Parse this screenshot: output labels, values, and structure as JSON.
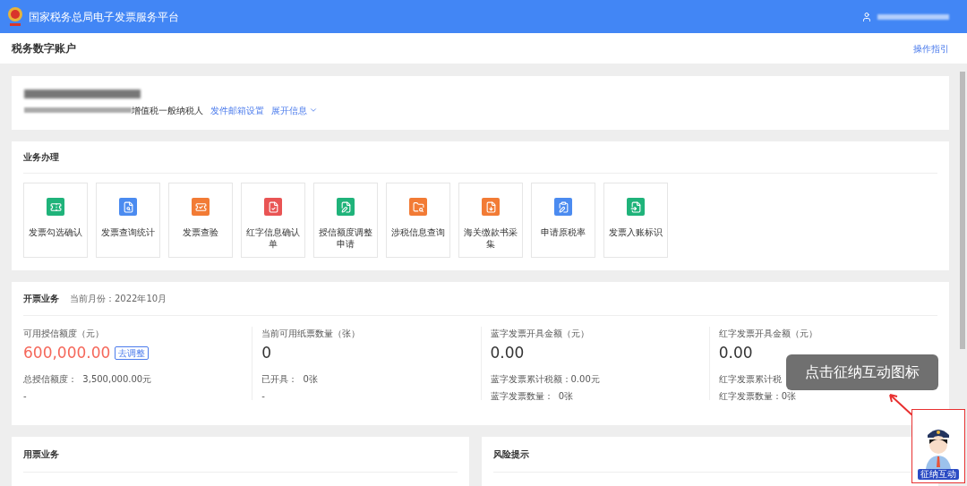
{
  "header": {
    "title": "国家税务总局电子发票服务平台"
  },
  "page": {
    "title": "税务数字账户",
    "guide_link": "操作指引"
  },
  "account": {
    "taxpayer_type": "增值税一般纳税人",
    "links": [
      {
        "label": "发件邮箱设置",
        "kind": "link"
      },
      {
        "label": "展开信息",
        "kind": "expand"
      }
    ]
  },
  "business": {
    "title": "业务办理",
    "items": [
      {
        "label": "发票勾选确认",
        "color": "#1fb37a"
      },
      {
        "label": "发票查询统计",
        "color": "#4b8bf0"
      },
      {
        "label": "发票查验",
        "color": "#f27b35"
      },
      {
        "label": "红字信息确认单",
        "color": "#e95454"
      },
      {
        "label": "授信额度调整申请",
        "color": "#1fb37a"
      },
      {
        "label": "涉税信息查询",
        "color": "#f27b35"
      },
      {
        "label": "海关缴款书采集",
        "color": "#f27b35"
      },
      {
        "label": "申请原税率",
        "color": "#4b8bf0"
      },
      {
        "label": "发票入账标识",
        "color": "#1fb37a"
      }
    ]
  },
  "invoicing": {
    "title": "开票业务",
    "month": "当前月份：2022年10月",
    "stats": [
      {
        "label": "可用授信额度（元）",
        "value": "600,000.00",
        "highlight": true,
        "action": "去调整",
        "lines": [
          "总授信额度：  3,500,000.00元",
          "-"
        ]
      },
      {
        "label": "当前可用纸票数量（张）",
        "value": "0",
        "highlight": false,
        "lines": [
          "已开具：  0张",
          "-"
        ]
      },
      {
        "label": "蓝字发票开具金额（元）",
        "value": "0.00",
        "highlight": false,
        "lines": [
          "蓝字发票累计税额：0.00元",
          "蓝字发票数量：  0张"
        ]
      },
      {
        "label": "红字发票开具金额（元）",
        "value": "0.00",
        "highlight": false,
        "lines": [
          "红字发票累计税",
          "红字发票数量：0张"
        ]
      }
    ]
  },
  "bottom_cards": [
    {
      "title": "用票业务"
    },
    {
      "title": "风险提示"
    }
  ],
  "callout": {
    "text": "点击征纳互动图标",
    "badge": "征纳互动"
  }
}
